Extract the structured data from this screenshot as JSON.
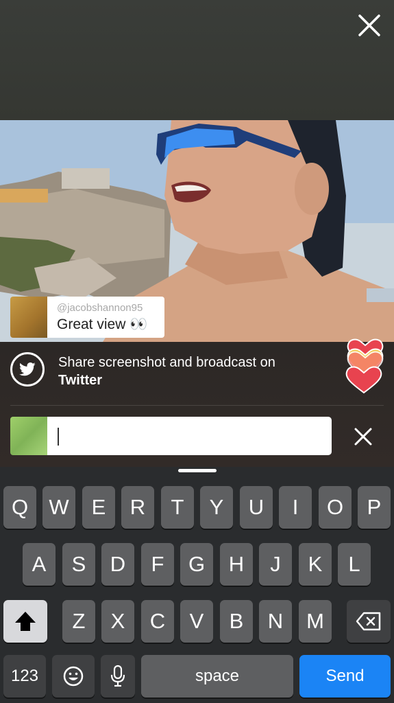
{
  "comment": {
    "username": "@jacobshannon95",
    "text": "Great view 👀"
  },
  "share": {
    "line1": "Share screenshot and broadcast on",
    "line2": "Twitter"
  },
  "input": {
    "value": "",
    "placeholder": ""
  },
  "keyboard": {
    "row1": [
      "Q",
      "W",
      "E",
      "R",
      "T",
      "Y",
      "U",
      "I",
      "O",
      "P"
    ],
    "row2": [
      "A",
      "S",
      "D",
      "F",
      "G",
      "H",
      "J",
      "K",
      "L"
    ],
    "row3": [
      "Z",
      "X",
      "C",
      "V",
      "B",
      "N",
      "M"
    ],
    "numbers_label": "123",
    "space_label": "space",
    "send_label": "Send"
  },
  "icons": {
    "close": "close-icon",
    "twitter": "twitter-bird-icon",
    "shift": "shift-arrow-icon",
    "delete": "backspace-icon",
    "emoji": "emoji-icon",
    "mic": "microphone-icon",
    "hearts": "hearts-icon"
  },
  "colors": {
    "send_button": "#1b84f5",
    "heart_red": "#e8434f",
    "heart_yellow": "#f2c94c"
  }
}
